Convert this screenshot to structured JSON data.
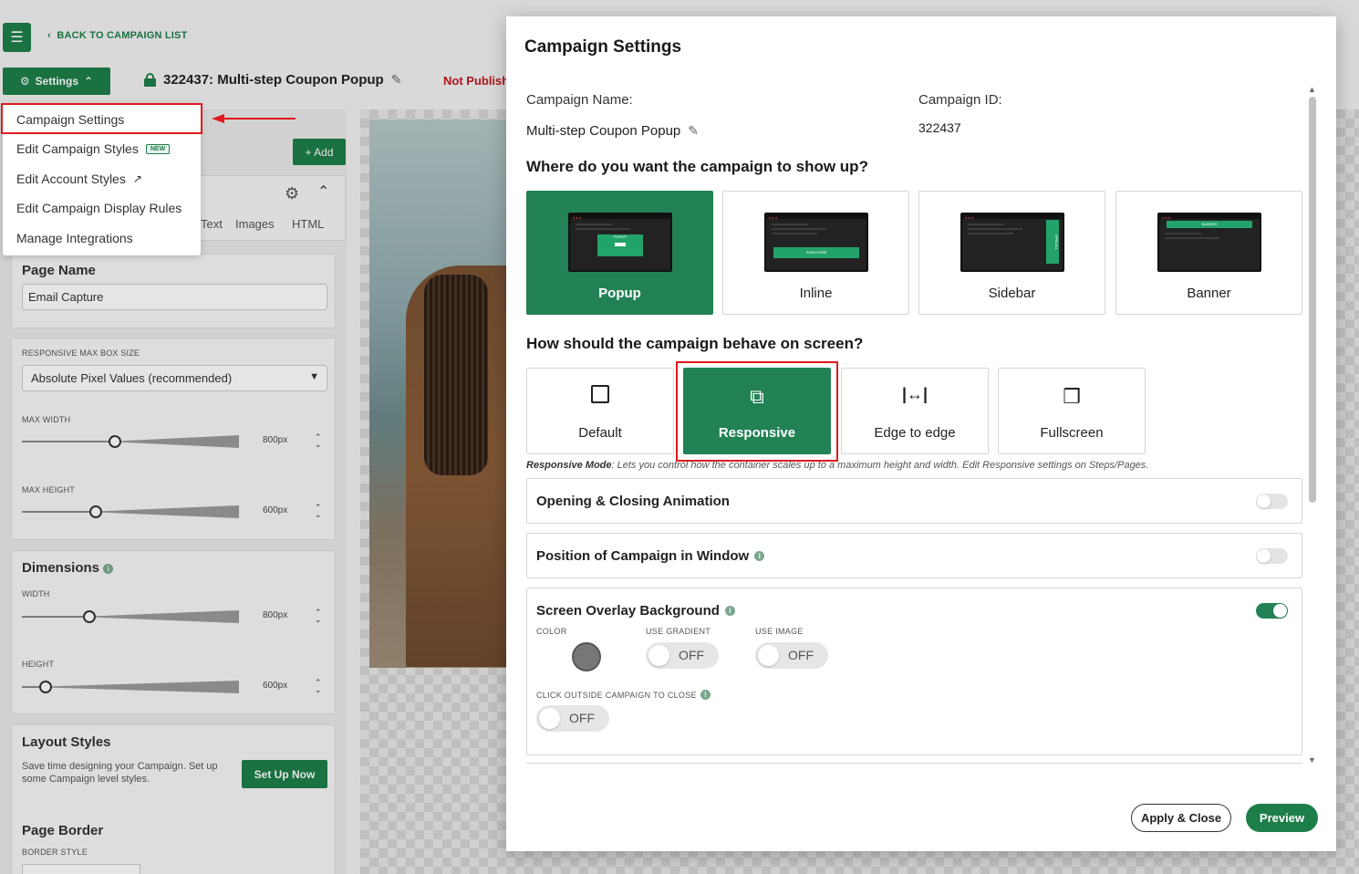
{
  "topbar": {
    "back_link": "BACK TO CAMPAIGN LIST",
    "settings_button": "Settings",
    "campaign_title": "322437: Multi-step Coupon Popup",
    "status": "Not Publish"
  },
  "settings_menu": {
    "items": [
      {
        "label": "Campaign Settings"
      },
      {
        "label": "Edit Campaign Styles",
        "badge": "NEW"
      },
      {
        "label": "Edit Account Styles"
      },
      {
        "label": "Edit Campaign Display Rules"
      },
      {
        "label": "Manage Integrations"
      }
    ]
  },
  "left_panel": {
    "add_button": "+ Add",
    "tabs": [
      "Text",
      "Images",
      "HTML"
    ],
    "page_name": {
      "title": "Page Name",
      "value": "Email Capture"
    },
    "responsive": {
      "label": "RESPONSIVE MAX BOX SIZE",
      "selected": "Absolute Pixel Values (recommended)",
      "max_width_label": "MAX WIDTH",
      "max_width_value": "800px",
      "max_width_fraction": 0.4,
      "max_height_label": "MAX HEIGHT",
      "max_height_value": "600px",
      "max_height_fraction": 0.31
    },
    "dimensions": {
      "title": "Dimensions",
      "width_label": "WIDTH",
      "width_value": "800px",
      "width_fraction": 0.28,
      "height_label": "HEIGHT",
      "height_value": "600px",
      "height_fraction": 0.08
    },
    "layout_styles": {
      "title": "Layout Styles",
      "description": "Save time designing your Campaign. Set up some Campaign level styles.",
      "button": "Set Up Now"
    },
    "page_border": {
      "title": "Page Border",
      "label": "BORDER STYLE"
    }
  },
  "modal": {
    "title": "Campaign Settings",
    "campaign_name_label": "Campaign Name:",
    "campaign_name_value": "Multi-step Coupon Popup",
    "campaign_id_label": "Campaign ID:",
    "campaign_id_value": "322437",
    "placement_question": "Where do you want the campaign to show up?",
    "placement_options": [
      {
        "label": "Popup",
        "mini_text": "POPUP",
        "active": true
      },
      {
        "label": "Inline",
        "mini_text": "SUBSCRIBE",
        "active": false
      },
      {
        "label": "Sidebar",
        "mini_text": "SPECIAL",
        "active": false
      },
      {
        "label": "Banner",
        "mini_text": "BANNER",
        "active": false
      }
    ],
    "behavior_question": "How should the campaign behave on screen?",
    "behavior_options": [
      {
        "label": "Default",
        "icon": "square-icon",
        "active": false
      },
      {
        "label": "Responsive",
        "icon": "external-link-icon",
        "active": true
      },
      {
        "label": "Edge to edge",
        "icon": "horizontal-arrows-icon",
        "active": false
      },
      {
        "label": "Fullscreen",
        "icon": "expand-icon",
        "active": false
      }
    ],
    "note_bold": "Responsive Mode",
    "note_text": ": Lets you control how the container scales up to a maximum height and width. Edit Responsive settings on Steps/Pages.",
    "sections": {
      "animation": {
        "title": "Opening & Closing Animation",
        "on": false
      },
      "position": {
        "title": "Position of Campaign in Window",
        "on": false
      },
      "overlay": {
        "title": "Screen Overlay Background",
        "on": true,
        "color_label": "COLOR",
        "color_value": "#777777",
        "gradient_label": "USE GRADIENT",
        "gradient_value": "OFF",
        "image_label": "USE IMAGE",
        "image_value": "OFF",
        "click_outside_label": "CLICK OUTSIDE CAMPAIGN TO CLOSE",
        "click_outside_value": "OFF"
      }
    },
    "apply_button": "Apply & Close",
    "preview_button": "Preview"
  },
  "colors": {
    "brand_green": "#1e7e4a",
    "active_green": "#228256",
    "highlight_red": "#e0191d"
  }
}
